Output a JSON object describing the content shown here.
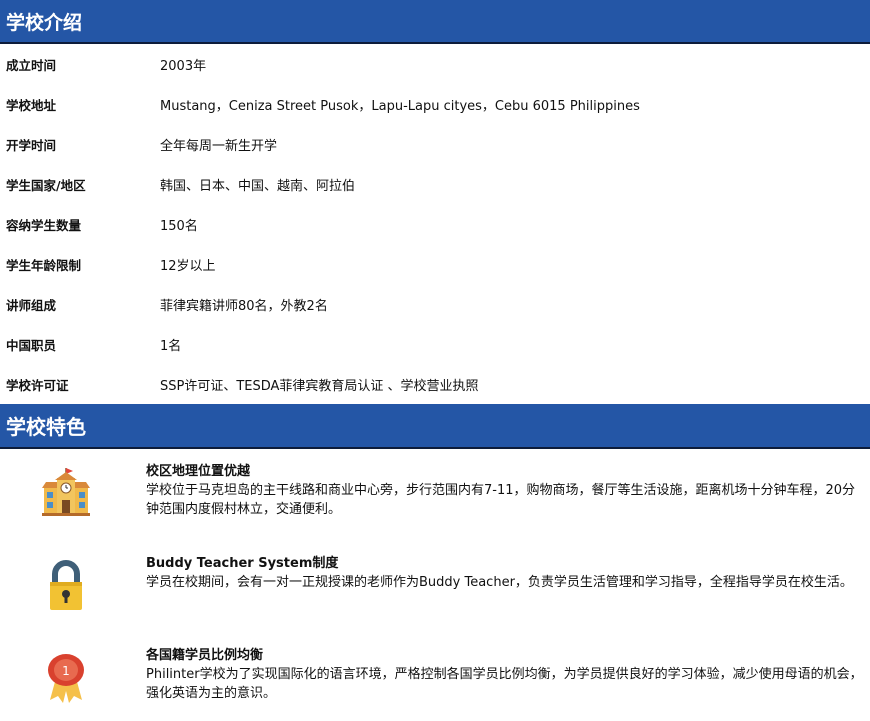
{
  "intro": {
    "title": "学校介绍",
    "rows": [
      {
        "label": "成立时间",
        "value": "2003年"
      },
      {
        "label": "学校地址",
        "value": "Mustang，Ceniza Street Pusok，Lapu-Lapu cityes，Cebu 6015 Philippines"
      },
      {
        "label": "开学时间",
        "value": "全年每周一新生开学"
      },
      {
        "label": "学生国家/地区",
        "value": "韩国、日本、中国、越南、阿拉伯"
      },
      {
        "label": "容纳学生数量",
        "value": "150名"
      },
      {
        "label": "学生年龄限制",
        "value": "12岁以上"
      },
      {
        "label": "讲师组成",
        "value": "菲律宾籍讲师80名，外教2名"
      },
      {
        "label": "中国职员",
        "value": "1名"
      },
      {
        "label": "学校许可证",
        "value": "SSP许可证、TESDA菲律宾教育局认证 、学校营业执照"
      }
    ]
  },
  "features": {
    "title": "学校特色",
    "items": [
      {
        "icon": "school-building-icon",
        "title": "校区地理位置优越",
        "desc": "学校位于马克坦岛的主干线路和商业中心旁，步行范围内有7-11，购物商场，餐厅等生活设施，距离机场十分钟车程，20分钟范围内度假村林立，交通便利。"
      },
      {
        "icon": "padlock-icon",
        "title": "Buddy Teacher System制度",
        "desc": "学员在校期间，会有一对一正规授课的老师作为Buddy Teacher，负责学员生活管理和学习指导，全程指导学员在校生活。"
      },
      {
        "icon": "medal-icon",
        "title": "各国籍学员比例均衡",
        "desc": "Philinter学校为了实现国际化的语言环境，严格控制各国学员比例均衡，为学员提供良好的学习体验，减少使用母语的机会，强化英语为主的意识。"
      }
    ]
  },
  "colors": {
    "header_bg": "#2456a6",
    "header_text": "#ffffff"
  }
}
